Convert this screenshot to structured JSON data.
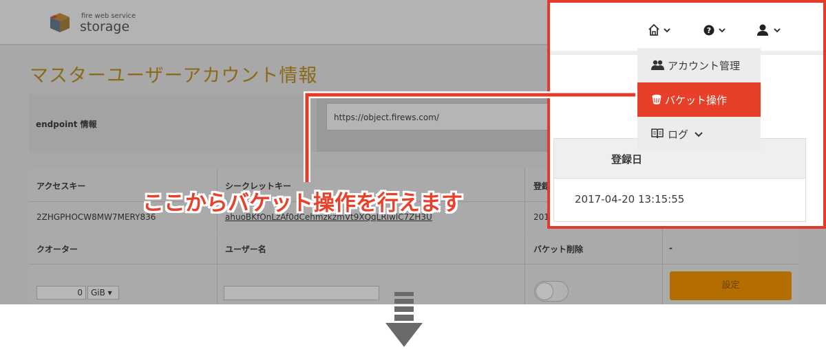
{
  "brand": {
    "subtitle": "fire web service",
    "name": "storage"
  },
  "page": {
    "title": "マスターユーザーアカウント情報"
  },
  "endpoint": {
    "label": "endpoint 情報",
    "value": "https://object.firews.com/"
  },
  "credentials_table": {
    "headers": [
      "アクセスキー",
      "シークレットキー",
      "登録"
    ],
    "row": [
      "2ZHGPHOCW8MW7MERY836",
      "ahuoBKfOnLzAf0dCehmzkzmVt9XQqLRlwlC7ZH3U",
      "201"
    ]
  },
  "settings_table": {
    "headers": [
      "クオーター",
      "ユーザー名",
      "バケット削除",
      "-"
    ],
    "quota_value": "0",
    "quota_unit": "GiB ▾",
    "settings_button": "設定"
  },
  "nav": {
    "icons": [
      "home-icon",
      "help-icon",
      "user-icon"
    ],
    "chevron": "⌄"
  },
  "dropdown": {
    "items": [
      {
        "label": "アカウント管理",
        "icon": "users-icon"
      },
      {
        "label": "バケット操作",
        "icon": "bucket-icon"
      },
      {
        "label": "ログ",
        "icon": "book-icon",
        "suffix": "⌄"
      }
    ]
  },
  "date_table": {
    "header": "登録日",
    "value": "2017-04-20 13:15:55"
  },
  "callout": {
    "text": "ここからバケット操作を行えます",
    "color": "#e8402a"
  },
  "colors": {
    "highlight": "#e23b2a",
    "selected_item": "#e84028",
    "settings_button": "#b36d00"
  }
}
